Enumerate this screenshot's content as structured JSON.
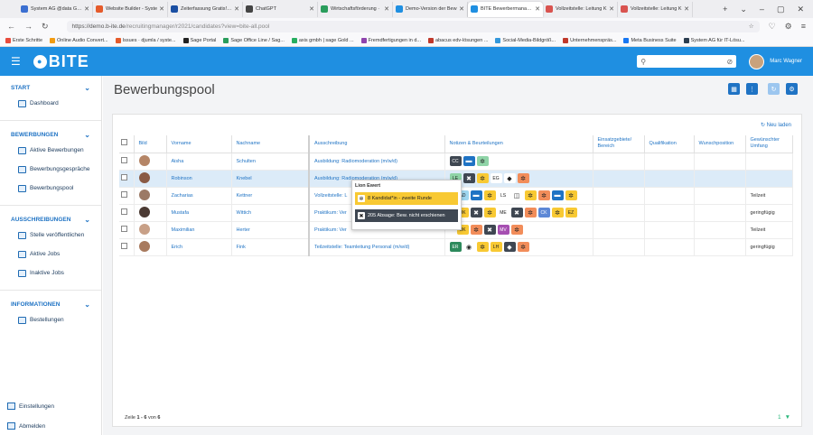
{
  "browser": {
    "tabs": [
      {
        "title": "System AG @data Gesk",
        "color": "#3b6fd1"
      },
      {
        "title": "Website Builder - Syste",
        "color": "#e55b2b"
      },
      {
        "title": "Zeiterfassung Gratis! W",
        "color": "#1b4fa3"
      },
      {
        "title": "ChatGPT",
        "color": "#444444"
      },
      {
        "title": "Wirtschaftsförderung ·",
        "color": "#2a9d5c"
      },
      {
        "title": "Demo-Version der Bew",
        "color": "#1f8fe1"
      },
      {
        "title": "BITE Bewerbermanager",
        "color": "#1f8fe1",
        "active": true
      },
      {
        "title": "Vollzeitstelle: Leitung K",
        "color": "#d9534f"
      },
      {
        "title": "Vollzeitstelle: Leitung K",
        "color": "#d9534f"
      }
    ],
    "url_host": "https://demo.b-ite.de",
    "url_path": "/recruitingmanager/r2021/candidates?view=bite-all.pool",
    "bookmarks": [
      "Erste Schritte",
      "Online Audio Convert...",
      "Issues · djumla / syste...",
      "Sage Portal",
      "Sage Office Line / Sag...",
      "axis gmbh | sage Gold ...",
      "Fremdfertigungen in d...",
      "abacus edv-lösungen ...",
      "Social-Media-Bildgröß...",
      "Unternehmenspräs...",
      "Meta Business Suite",
      "System AG für IT-Lösu..."
    ]
  },
  "header": {
    "brand": "BITE",
    "user": "Marc Wagner"
  },
  "sidebar": {
    "start": {
      "title": "START",
      "items": [
        "Dashboard"
      ]
    },
    "bewerbungen": {
      "title": "BEWERBUNGEN",
      "items": [
        "Aktive Bewerbungen",
        "Bewerbungsgespräche",
        "Bewerbungspool"
      ]
    },
    "ausschreibungen": {
      "title": "AUSSCHREIBUNGEN",
      "items": [
        "Stelle veröffentlichen",
        "Aktive Jobs",
        "Inaktive Jobs"
      ]
    },
    "informationen": {
      "title": "INFORMATIONEN",
      "items": [
        "Bestellungen"
      ]
    },
    "bottom": [
      "Einstellungen",
      "Abmelden"
    ]
  },
  "page": {
    "title": "Bewerbungspool",
    "reload": "Neu laden"
  },
  "table": {
    "headers": [
      "Bild",
      "Vorname",
      "Nachname",
      "Ausschreibung",
      "Notizen & Beurteilungen",
      "Einsatzgebiete/ Bereich",
      "Qualifikation",
      "Wunschposition",
      "Gewünschter Umfang"
    ],
    "rows": [
      {
        "first": "Aisha",
        "last": "Schulten",
        "job": "Ausbildung: Radiomoderation (m/w/d)",
        "umfang": "",
        "pic": "#b58566"
      },
      {
        "first": "Robinson",
        "last": "Knebel",
        "job": "Ausbildung: Radiomoderation (m/w/d)",
        "umfang": "",
        "pic": "#8a5a44",
        "hl": true
      },
      {
        "first": "Zacharias",
        "last": "Kettner",
        "job": "Vollzeitstelle: L",
        "umfang": "Teilzeit",
        "pic": "#9c7a66"
      },
      {
        "first": "Mustafa",
        "last": "Wittich",
        "job": "Praktikum: Ver",
        "umfang": "geringfügig",
        "pic": "#4b3a33"
      },
      {
        "first": "Maximilian",
        "last": "Herter",
        "job": "Praktikum: Ver",
        "umfang": "Teilzeit",
        "pic": "#c8a087"
      },
      {
        "first": "Erich",
        "last": "Fink",
        "job": "Teilzeitstelle: Teamleitung Personal (m/w/d)",
        "umfang": "geringfügig",
        "pic": "#a87a5e"
      }
    ]
  },
  "notes": {
    "r1": [
      "CC"
    ],
    "r2": [
      "LE",
      "EG"
    ],
    "r3": [
      "AD",
      "LS"
    ],
    "r4": [
      "OK",
      "ME",
      "CK",
      "EZ"
    ],
    "r5": [
      "OK",
      "MV"
    ],
    "r6": [
      "ER",
      "LH"
    ]
  },
  "popup": {
    "name": "Lion Ewert",
    "entry1": "8 Kandidat*in - zweite Runde",
    "entry2": "205 Absage: Bew. nicht erschienen"
  },
  "footer": {
    "prefix": "Zeile",
    "range": "1 - 6",
    "of": "von",
    "total": "6"
  },
  "pager": {
    "page": "1"
  }
}
